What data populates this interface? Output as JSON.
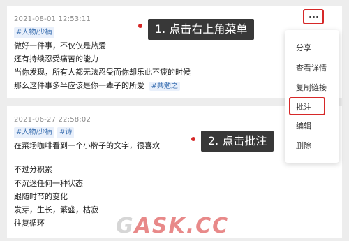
{
  "posts": [
    {
      "timestamp": "2021-08-01 12:53:11",
      "tags": [
        "#人物/少楠"
      ],
      "lines": [
        "做好一件事，不仅仅是热爱",
        "还有持续忍受痛苦的能力",
        "当你发现，所有人都无法忍受而你却乐此不疲的时候",
        "那么这件事多半应该是你一辈子的所爱"
      ],
      "inline_tag": "#共勉之"
    },
    {
      "timestamp": "2021-06-27 22:58:02",
      "tags": [
        "#人物/少楠",
        "#诗"
      ],
      "lines": [
        "在菜场咖啡看到一个小牌子的文字，很喜欢",
        "",
        "不过分积累",
        "不沉迷任何一种状态",
        "跟随时节的变化",
        "发芽，生长，繁盛，枯寂",
        "往复循环"
      ]
    }
  ],
  "more_menu": {
    "icon": "more-dots-icon",
    "items": [
      "分享",
      "查看详情",
      "复制链接",
      "批注",
      "编辑",
      "删除"
    ],
    "highlighted": "批注"
  },
  "callouts": {
    "step1": "1. 点击右上角菜单",
    "step2": "2. 点击批注"
  },
  "watermark": {
    "part1": "G",
    "part2": "ASK.CC"
  },
  "colors": {
    "highlight": "#d62828",
    "tag_text": "#3a6fb0",
    "tag_bg": "#e9f0fb",
    "callout_bg": "#383838"
  }
}
